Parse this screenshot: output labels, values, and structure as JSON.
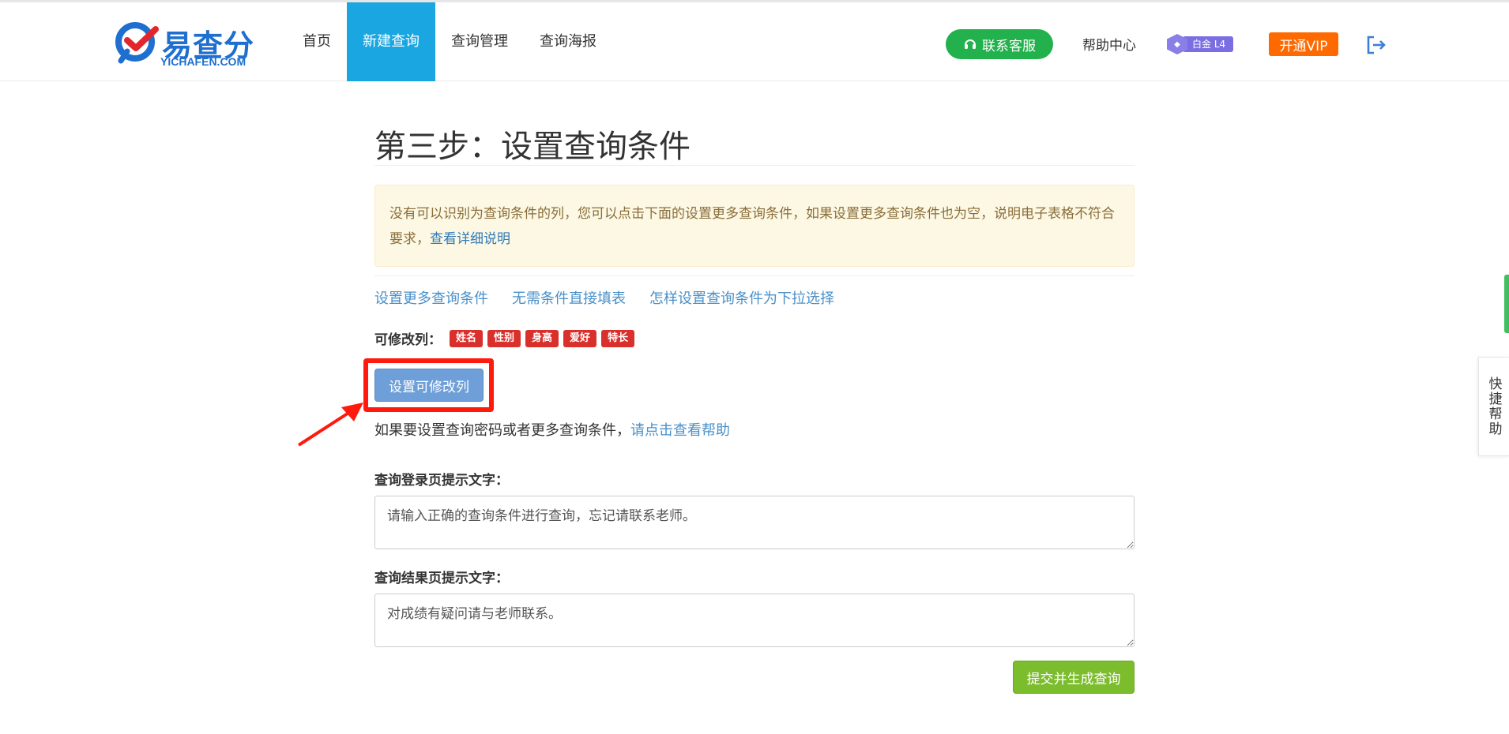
{
  "header": {
    "logo_text": "易查分",
    "logo_sub": "YICHAFEN.COM",
    "nav": [
      {
        "label": "首页",
        "active": false
      },
      {
        "label": "新建查询",
        "active": true
      },
      {
        "label": "查询管理",
        "active": false
      },
      {
        "label": "查询海报",
        "active": false
      }
    ],
    "service_label": "联系客服",
    "help_center_label": "帮助中心",
    "level_label": "白金 L4",
    "vip_label": "开通VIP",
    "logout_icon": "logout-icon"
  },
  "main": {
    "title": "第三步：设置查询条件",
    "alert_text": "没有可以识别为查询条件的列，您可以点击下面的设置更多查询条件，如果设置更多查询条件也为空，说明电子表格不符合要求，",
    "alert_link": "查看详细说明",
    "links": [
      {
        "label": "设置更多查询条件"
      },
      {
        "label": "无需条件直接填表"
      },
      {
        "label": "怎样设置查询条件为下拉选择"
      }
    ],
    "editable_label": "可修改列：",
    "editable_tags": [
      {
        "label": "姓名"
      },
      {
        "label": "性别"
      },
      {
        "label": "身高"
      },
      {
        "label": "爱好"
      },
      {
        "label": "特长"
      }
    ],
    "editable_button": "设置可修改列",
    "help_text": "如果要设置查询密码或者更多查询条件，",
    "help_link": "请点击查看帮助",
    "login_tip_label": "查询登录页提示文字：",
    "login_tip_value": "请输入正确的查询条件进行查询，忘记请联系老师。",
    "result_tip_label": "查询结果页提示文字：",
    "result_tip_value": "对成绩有疑问请与老师联系。",
    "submit_label": "提交并生成查询"
  },
  "side": {
    "quick_help": "快捷帮助"
  },
  "colors": {
    "nav_active": "#1aa6e0",
    "service": "#22b14c",
    "vip": "#ff6a00",
    "tag": "#d9302c",
    "submit": "#7cbd2d",
    "highlight": "#ff1a0d"
  }
}
